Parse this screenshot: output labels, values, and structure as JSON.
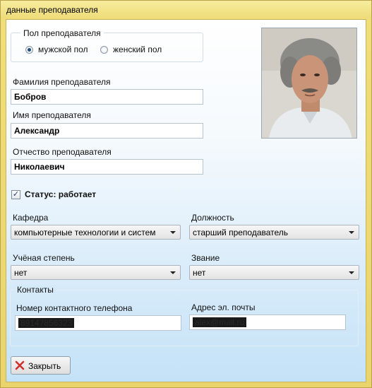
{
  "window": {
    "title": "данные преподавателя"
  },
  "gender": {
    "caption": "Пол  преподавателя",
    "options": [
      {
        "label": "мужской пол",
        "selected": true
      },
      {
        "label": "женский пол",
        "selected": false
      }
    ]
  },
  "fields": {
    "surname": {
      "label": "Фамилия преподавателя",
      "value": "Бобров"
    },
    "name": {
      "label": "Имя преподавателя",
      "value": "Александр"
    },
    "patronymic": {
      "label": "Отчество преподавателя",
      "value": "Николаевич"
    }
  },
  "status": {
    "label": "Статус: работает",
    "checked": true
  },
  "department": {
    "label": "Кафедра",
    "value": "компьютерные технологии и систем"
  },
  "position": {
    "label": "Должность",
    "value": "старший преподаватель"
  },
  "degree": {
    "label": "Учёная степень",
    "value": "нет"
  },
  "rank": {
    "label": "Звание",
    "value": "нет"
  },
  "contacts": {
    "caption": "Контакты",
    "phone": {
      "label": "Номер контактного телефона",
      "value": "89147856323"
    },
    "email": {
      "label": "Адрес эл. почты",
      "value": "alex@mail.ru"
    }
  },
  "close_button": {
    "label": "Закрыть",
    "icon": "close-x-icon",
    "icon_color": "#d0312d"
  }
}
